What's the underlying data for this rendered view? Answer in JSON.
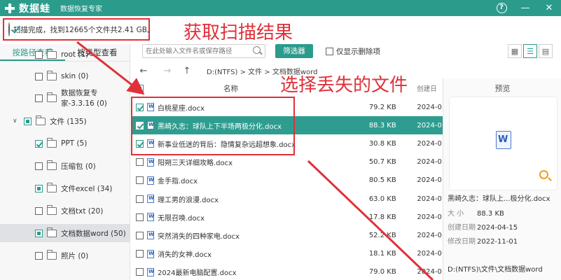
{
  "titlebar": {
    "app_name": "数据蛙",
    "subtitle": "数据恢复专家",
    "help_label": "?",
    "minimize_label": "—",
    "close_label": "✕"
  },
  "status": {
    "text": "扫描完成，找到12665个文件共2.41 GB。"
  },
  "annotations": {
    "scan_result": "获取扫描结果",
    "select_files": "选择丢失的文件"
  },
  "colors": {
    "brand": "#2b9b8c",
    "annotation_red": "#e0303a",
    "selected_row": "#2e9d8f"
  },
  "left_tabs": [
    {
      "label": "按路径查看",
      "active": true
    },
    {
      "label": "按类型查看",
      "active": false
    }
  ],
  "tree": [
    {
      "label": "root (1)",
      "state": "unchecked"
    },
    {
      "label": "skin (0)",
      "state": "unchecked"
    },
    {
      "label": "数据恢复专家-3.3.16 (0)",
      "state": "unchecked"
    },
    {
      "label": "文件 (135)",
      "state": "partial",
      "expanded": true
    },
    {
      "label": "PPT (5)",
      "state": "checked"
    },
    {
      "label": "压缩包 (0)",
      "state": "unchecked"
    },
    {
      "label": "文件excel (34)",
      "state": "partial"
    },
    {
      "label": "文档txt (20)",
      "state": "unchecked"
    },
    {
      "label": "文档数据word (50)",
      "state": "partial",
      "selected": true
    },
    {
      "label": "照片 (0)",
      "state": "unchecked"
    }
  ],
  "toolbar": {
    "search_placeholder": "在此处输入文件名或保存路径",
    "filter_label": "筛选器",
    "only_deleted_label": "仅显示删除项",
    "view_grid_icon": "grid-view-icon",
    "view_list_icon": "list-view-icon",
    "view_detail_icon": "detail-view-icon"
  },
  "nav": {
    "path": "D:(NTFS)  >  文件  >  文档数据word"
  },
  "table": {
    "headers": {
      "name": "名称",
      "size": "",
      "date": "创建日"
    },
    "rows": [
      {
        "name": "白桃星座.docx",
        "size": "79.2 KB",
        "date": "2024-0",
        "checked": true,
        "highlight": false
      },
      {
        "name": "黑崎久志：球队上下半场两极分化.docx",
        "size": "88.3 KB",
        "date": "2024-0",
        "checked": true,
        "highlight": true
      },
      {
        "name": "新事业低迷的背后：隐情复杂远超想象.docx",
        "size": "30.8 KB",
        "date": "2024-0",
        "checked": true,
        "highlight": false
      },
      {
        "name": "阳朔三天详细攻略.docx",
        "size": "50.7 KB",
        "date": "2024-0",
        "checked": false,
        "highlight": false
      },
      {
        "name": "金手指.docx",
        "size": "80.5 KB",
        "date": "2024-0",
        "checked": false,
        "highlight": false
      },
      {
        "name": "理工男的浪漫.docx",
        "size": "63.0 KB",
        "date": "2024-0",
        "checked": false,
        "highlight": false
      },
      {
        "name": "无限召唤.docx",
        "size": "17.8 KB",
        "date": "2024-0",
        "checked": false,
        "highlight": false
      },
      {
        "name": "突然消失的四种家电.docx",
        "size": "52.2 KB",
        "date": "2024-0",
        "checked": false,
        "highlight": false
      },
      {
        "name": "消失的女神.docx",
        "size": "18.1 KB",
        "date": "2024-0",
        "checked": false,
        "highlight": false
      },
      {
        "name": "2024最新电脑配置.docx",
        "size": "79.0 KB",
        "date": "2024-0",
        "checked": false,
        "highlight": false
      }
    ]
  },
  "preview": {
    "title": "预览",
    "file_name": "黑崎久志：球队上...极分化.docx",
    "size_label": "大  小",
    "size": "88.3 KB",
    "created_label": "创建日期",
    "created": "2024-04-15",
    "modified_label": "修改日期",
    "modified": "2022-11-01",
    "path": "D:(NTFS)\\文件\\文档数据word"
  }
}
